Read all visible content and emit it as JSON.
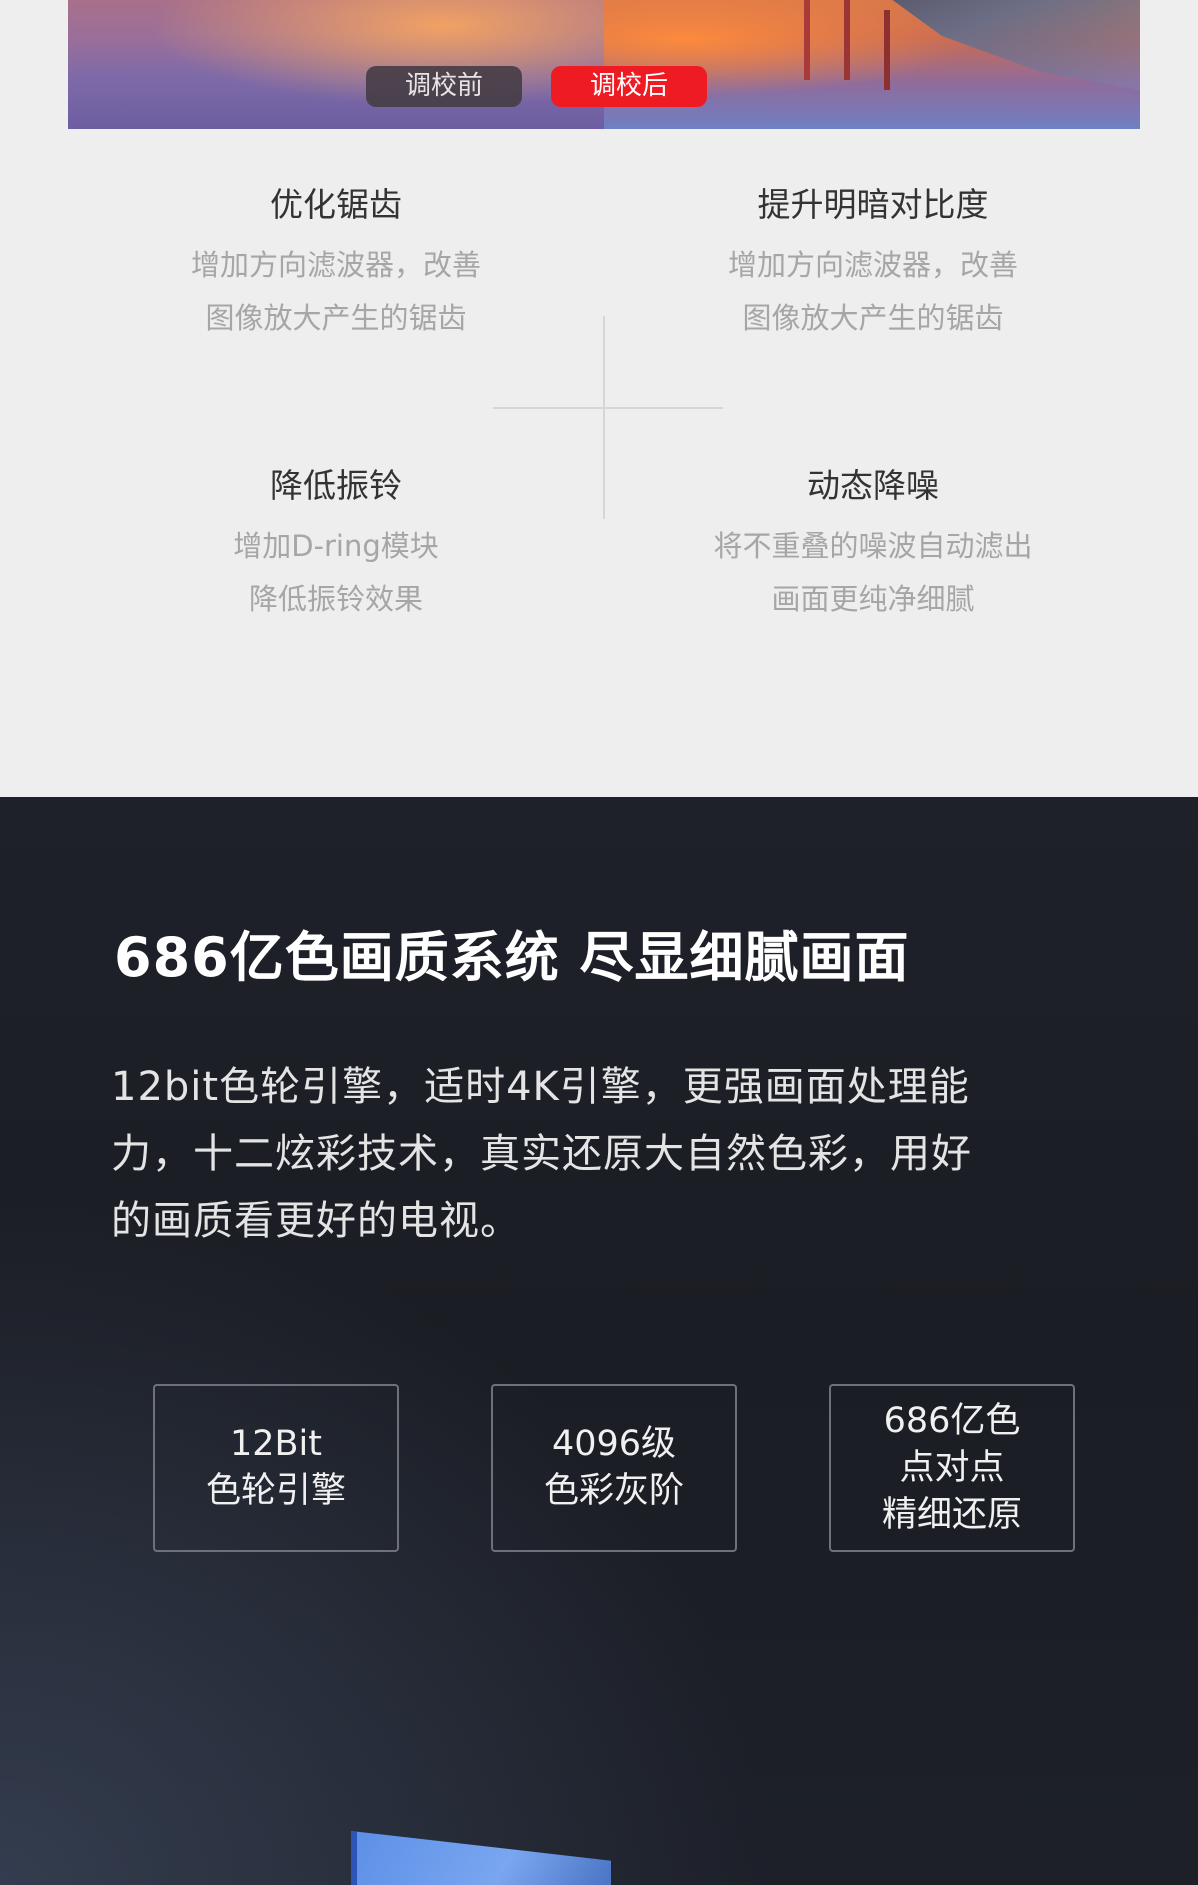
{
  "comparison": {
    "before_label": "调校前",
    "after_label": "调校后"
  },
  "features": [
    {
      "title": "优化锯齿",
      "desc_line1": "增加方向滤波器，改善",
      "desc_line2": "图像放大产生的锯齿"
    },
    {
      "title": "提升明暗对比度",
      "desc_line1": "增加方向滤波器，改善",
      "desc_line2": "图像放大产生的锯齿"
    },
    {
      "title": "降低振铃",
      "desc_line1": "增加D-ring模块",
      "desc_line2": "降低振铃效果"
    },
    {
      "title": "动态降噪",
      "desc_line1": "将不重叠的噪波自动滤出",
      "desc_line2": "画面更纯净细腻"
    }
  ],
  "color_system": {
    "headline": "686亿色画质系统 尽显细腻画面",
    "paragraph_line1": "12bit色轮引擎，适时4K引擎，更强画面处理能",
    "paragraph_line2": "力，十二炫彩技术，真实还原大自然色彩，用好",
    "paragraph_line3": "的画质看更好的电视。",
    "boxes": [
      {
        "lines": [
          "12Bit",
          "色轮引擎"
        ]
      },
      {
        "lines": [
          "4096级",
          "色彩灰阶"
        ]
      },
      {
        "lines": [
          "686亿色",
          "点对点",
          "精细还原"
        ]
      }
    ]
  },
  "colors": {
    "page_bg": "#eeeeee",
    "dark_bg": "#1e2129",
    "accent_red": "#ee1b23",
    "tv_blue": "#5b8fe6"
  }
}
